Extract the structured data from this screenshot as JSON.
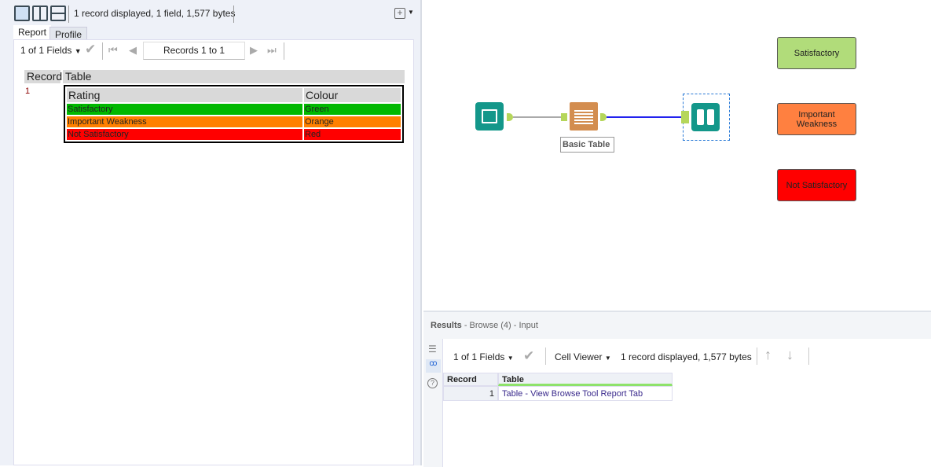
{
  "left_panel": {
    "status": "1 record displayed, 1 field, 1,577 bytes",
    "tabs": [
      "Report",
      "Profile"
    ],
    "fields_label": "1 of 1 Fields",
    "records_label": "Records 1 to 1",
    "report": {
      "headers": [
        "Record",
        "Table"
      ],
      "record_num": "1",
      "table_headers": [
        "Rating",
        "Colour"
      ],
      "rows": [
        {
          "rating": "Satisfactory",
          "colour": "Green",
          "bg": "#00b800"
        },
        {
          "rating": "Important Weakness",
          "colour": "Orange",
          "bg": "#ff8000"
        },
        {
          "rating": "Not Satisfactory",
          "colour": "Red",
          "bg": "#ff0000"
        }
      ]
    }
  },
  "canvas": {
    "tool_label": "Basic Table",
    "notes": [
      {
        "text": "Satisfactory",
        "bg": "#b1dc7a"
      },
      {
        "text": "Important Weakness",
        "bg": "#ff8040"
      },
      {
        "text": "Not Satisfactory",
        "bg": "#ff0000"
      }
    ]
  },
  "results": {
    "title": "Results",
    "subtitle": "- Browse (4) - Input",
    "fields_label": "1 of 1 Fields",
    "viewer": "Cell Viewer",
    "status": "1 record displayed, 1,577 bytes",
    "columns": [
      "Record",
      "Table"
    ],
    "row": {
      "record": "1",
      "table": "Table - View Browse Tool Report Tab"
    }
  }
}
